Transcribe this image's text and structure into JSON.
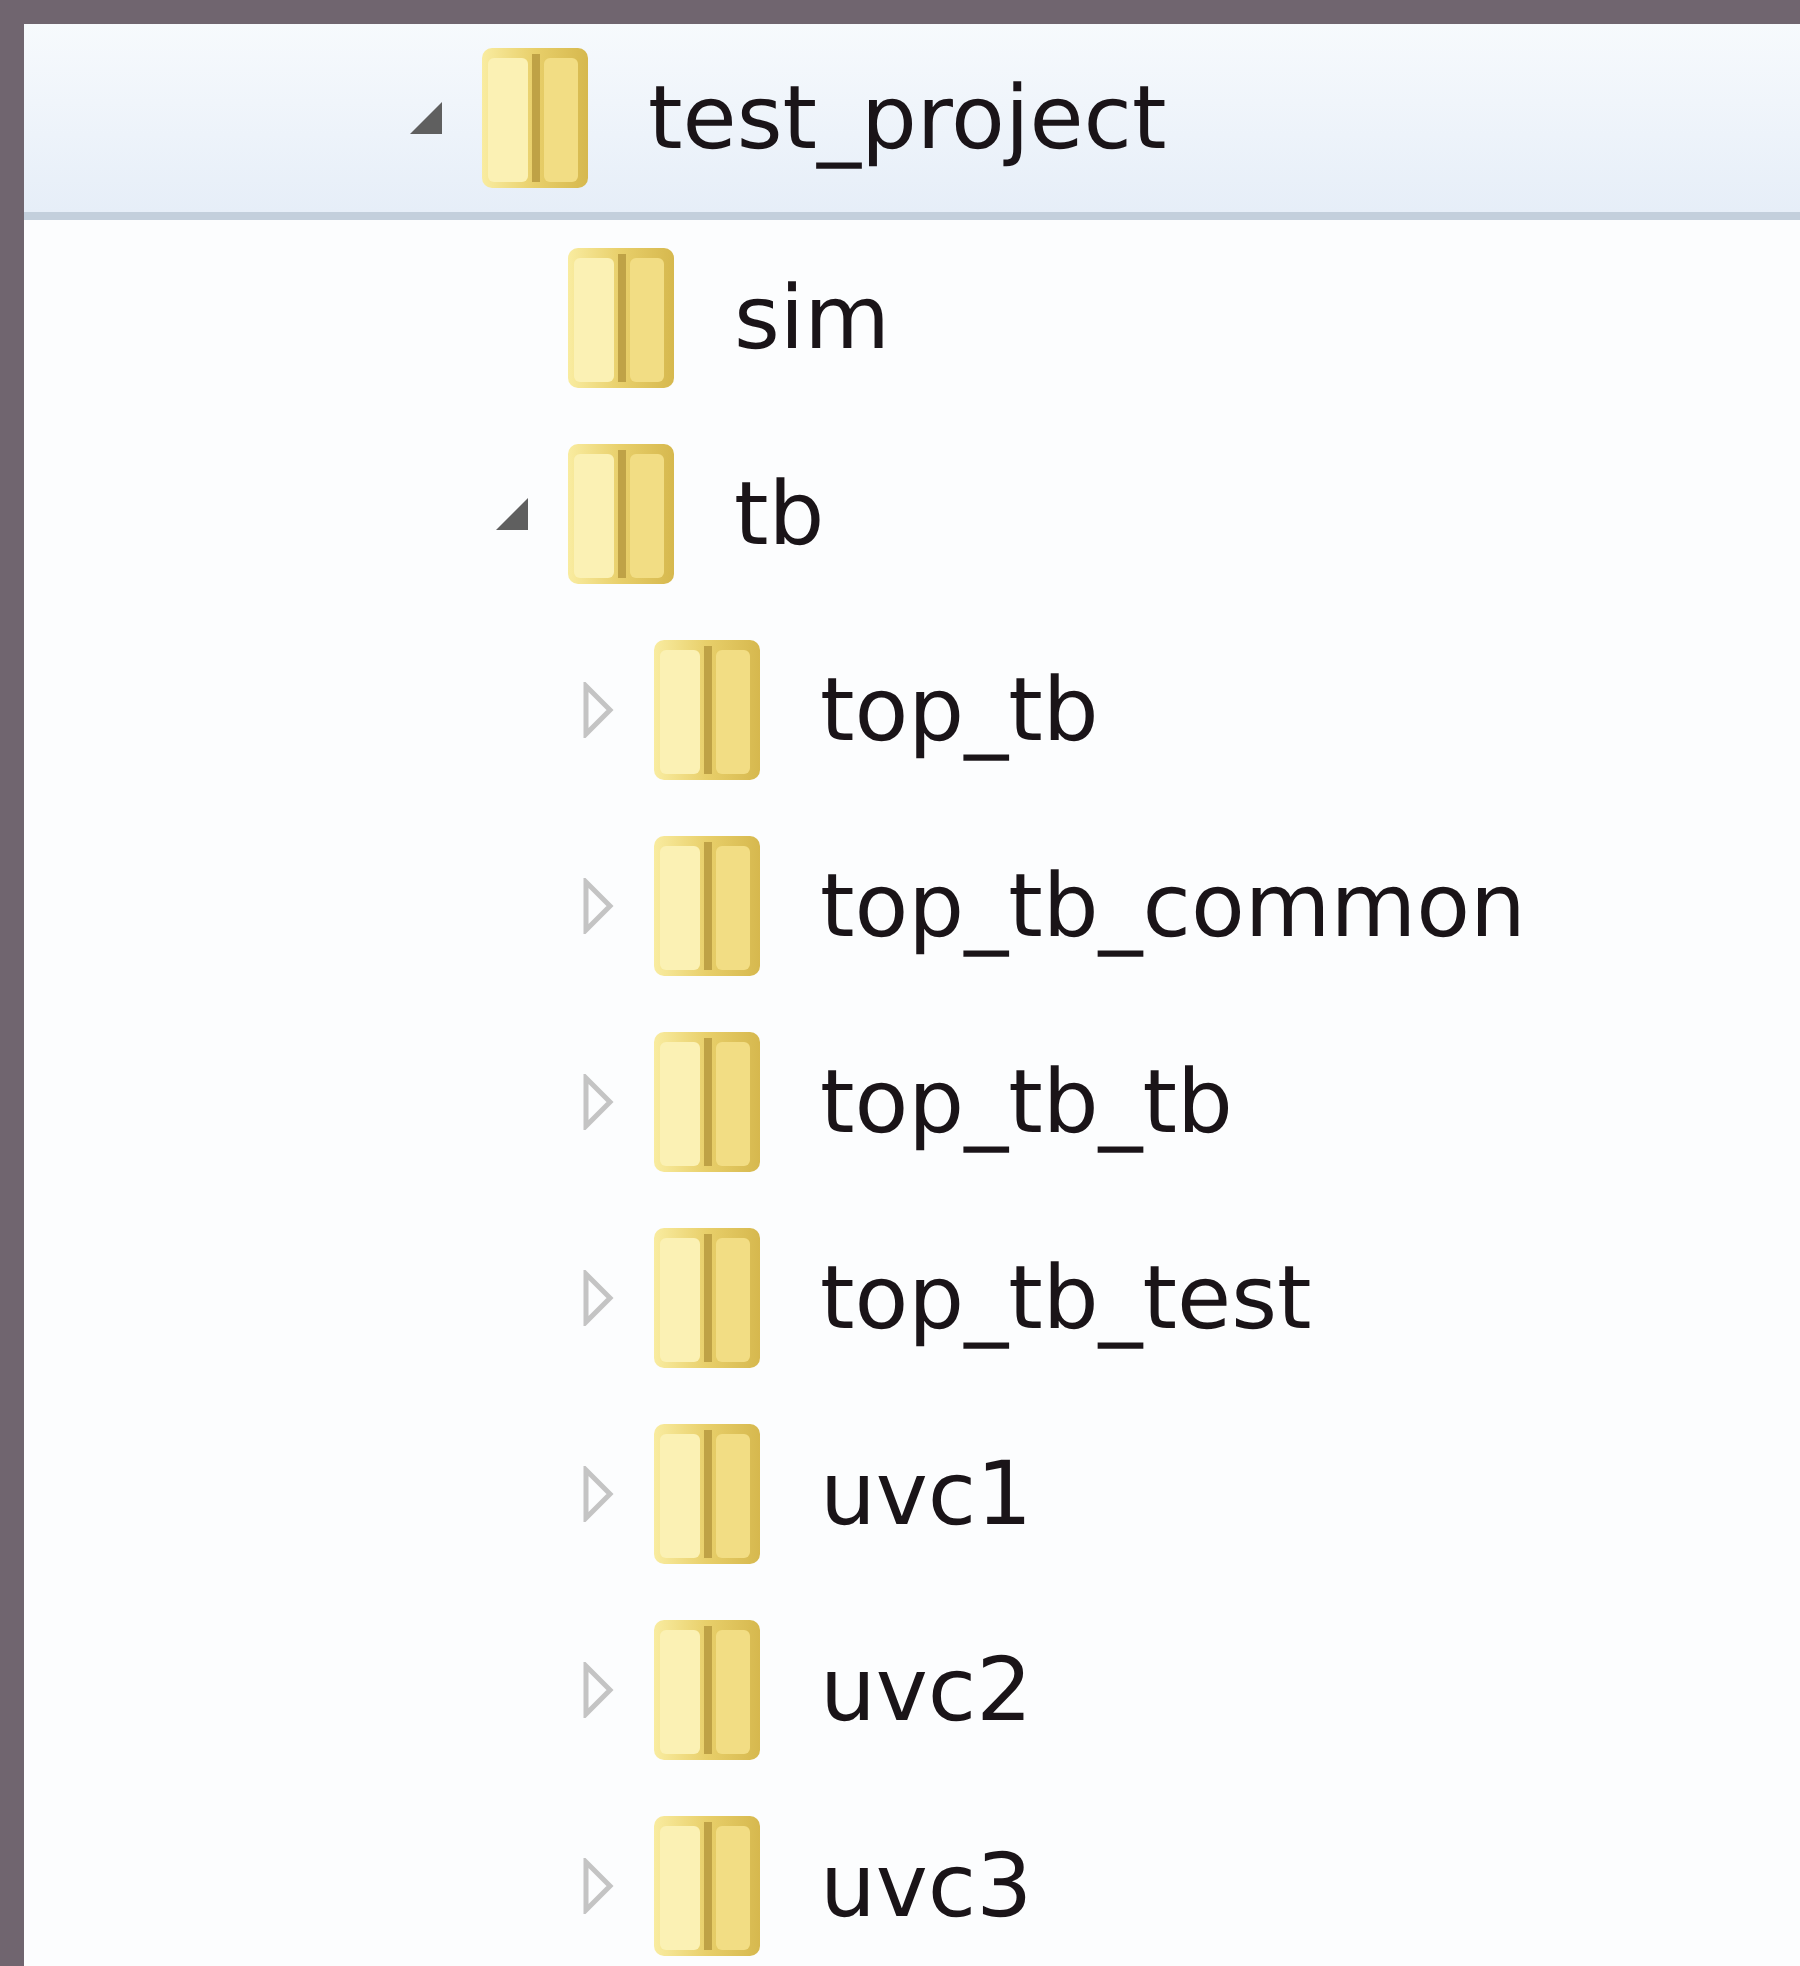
{
  "folder_tree": [
    {
      "label": "test_project",
      "kind": "branch",
      "expanded": true,
      "selected": true,
      "children": [
        {
          "label": "sim",
          "kind": "leaf",
          "selected": false
        },
        {
          "label": "tb",
          "kind": "branch",
          "expanded": true,
          "selected": false,
          "children": [
            {
              "label": "top_tb",
              "kind": "branch",
              "expanded": false,
              "selected": false
            },
            {
              "label": "top_tb_common",
              "kind": "branch",
              "expanded": false,
              "selected": false
            },
            {
              "label": "top_tb_tb",
              "kind": "branch",
              "expanded": false,
              "selected": false
            },
            {
              "label": "top_tb_test",
              "kind": "branch",
              "expanded": false,
              "selected": false
            },
            {
              "label": "uvc1",
              "kind": "branch",
              "expanded": false,
              "selected": false
            },
            {
              "label": "uvc2",
              "kind": "branch",
              "expanded": false,
              "selected": false
            },
            {
              "label": "uvc3",
              "kind": "branch",
              "expanded": false,
              "selected": false
            }
          ]
        }
      ]
    }
  ]
}
